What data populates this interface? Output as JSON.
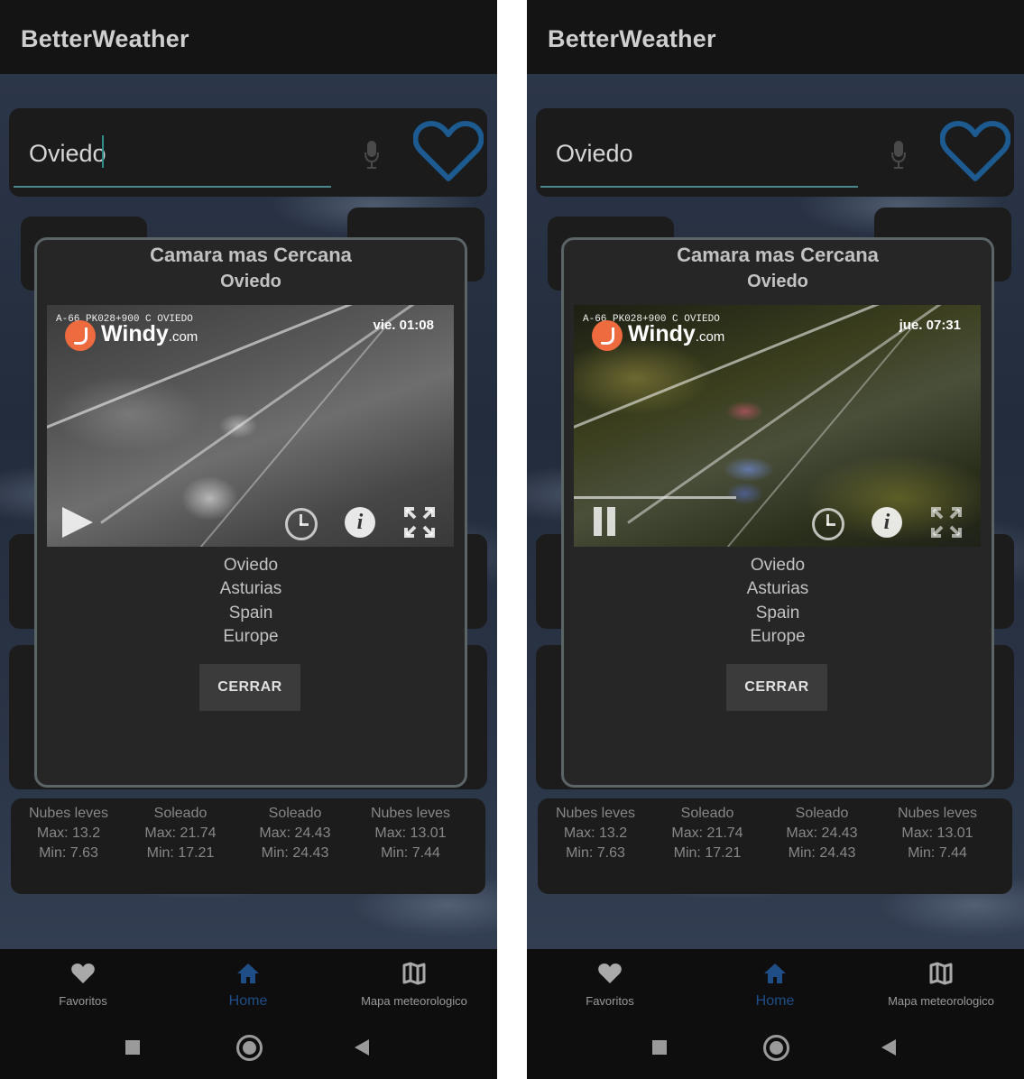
{
  "screens": [
    {
      "app_title": "BetterWeather",
      "search": {
        "value": "Oviedo",
        "focused": true
      },
      "dialog": {
        "title": "Camara mas Cercana",
        "subtitle": "Oviedo",
        "camera": {
          "code_label": "A-66 PK028+900 C OVIEDO",
          "provider": "Windy",
          "provider_suffix": ".com",
          "timestamp": "vie. 01:08",
          "mode": "night-bw",
          "play_state": "paused",
          "icons": [
            "play-icon",
            "clock-icon",
            "info-icon",
            "fullscreen-icon"
          ]
        },
        "location": [
          "Oviedo",
          "Asturias",
          "Spain",
          "Europe"
        ],
        "close_label": "CERRAR"
      },
      "forecast": [
        {
          "desc": "Nubes leves",
          "max": "Max: 13.2",
          "min": "Min: 7.63"
        },
        {
          "desc": "Soleado",
          "max": "Max: 21.74",
          "min": "Min: 17.21"
        },
        {
          "desc": "Soleado",
          "max": "Max: 24.43",
          "min": "Min: 24.43"
        },
        {
          "desc": "Nubes leves",
          "max": "Max: 13.01",
          "min": "Min: 7.44"
        }
      ],
      "nav": [
        {
          "label": "Favoritos",
          "icon": "heart-icon",
          "active": false
        },
        {
          "label": "Home",
          "icon": "home-icon",
          "active": true
        },
        {
          "label": "Mapa meteorologico",
          "icon": "map-icon",
          "active": false
        }
      ],
      "colors": {
        "accent": "#1f4e86",
        "heart": "#1c5a8f",
        "windy": "#ee6a3f"
      }
    },
    {
      "app_title": "BetterWeather",
      "search": {
        "value": "Oviedo",
        "focused": false
      },
      "dialog": {
        "title": "Camara mas Cercana",
        "subtitle": "Oviedo",
        "camera": {
          "code_label": "A-66 PK028+900 C OVIEDO",
          "provider": "Windy",
          "provider_suffix": ".com",
          "timestamp": "jue. 07:31",
          "mode": "night-color",
          "play_state": "playing",
          "icons": [
            "pause-icon",
            "clock-icon",
            "info-icon",
            "fullscreen-icon"
          ]
        },
        "location": [
          "Oviedo",
          "Asturias",
          "Spain",
          "Europe"
        ],
        "close_label": "CERRAR"
      },
      "forecast": [
        {
          "desc": "Nubes leves",
          "max": "Max: 13.2",
          "min": "Min: 7.63"
        },
        {
          "desc": "Soleado",
          "max": "Max: 21.74",
          "min": "Min: 17.21"
        },
        {
          "desc": "Soleado",
          "max": "Max: 24.43",
          "min": "Min: 24.43"
        },
        {
          "desc": "Nubes leves",
          "max": "Max: 13.01",
          "min": "Min: 7.44"
        }
      ],
      "nav": [
        {
          "label": "Favoritos",
          "icon": "heart-icon",
          "active": false
        },
        {
          "label": "Home",
          "icon": "home-icon",
          "active": true
        },
        {
          "label": "Mapa meteorologico",
          "icon": "map-icon",
          "active": false
        }
      ],
      "colors": {
        "accent": "#1f4e86",
        "heart": "#1c5a8f",
        "windy": "#ee6a3f"
      }
    }
  ]
}
